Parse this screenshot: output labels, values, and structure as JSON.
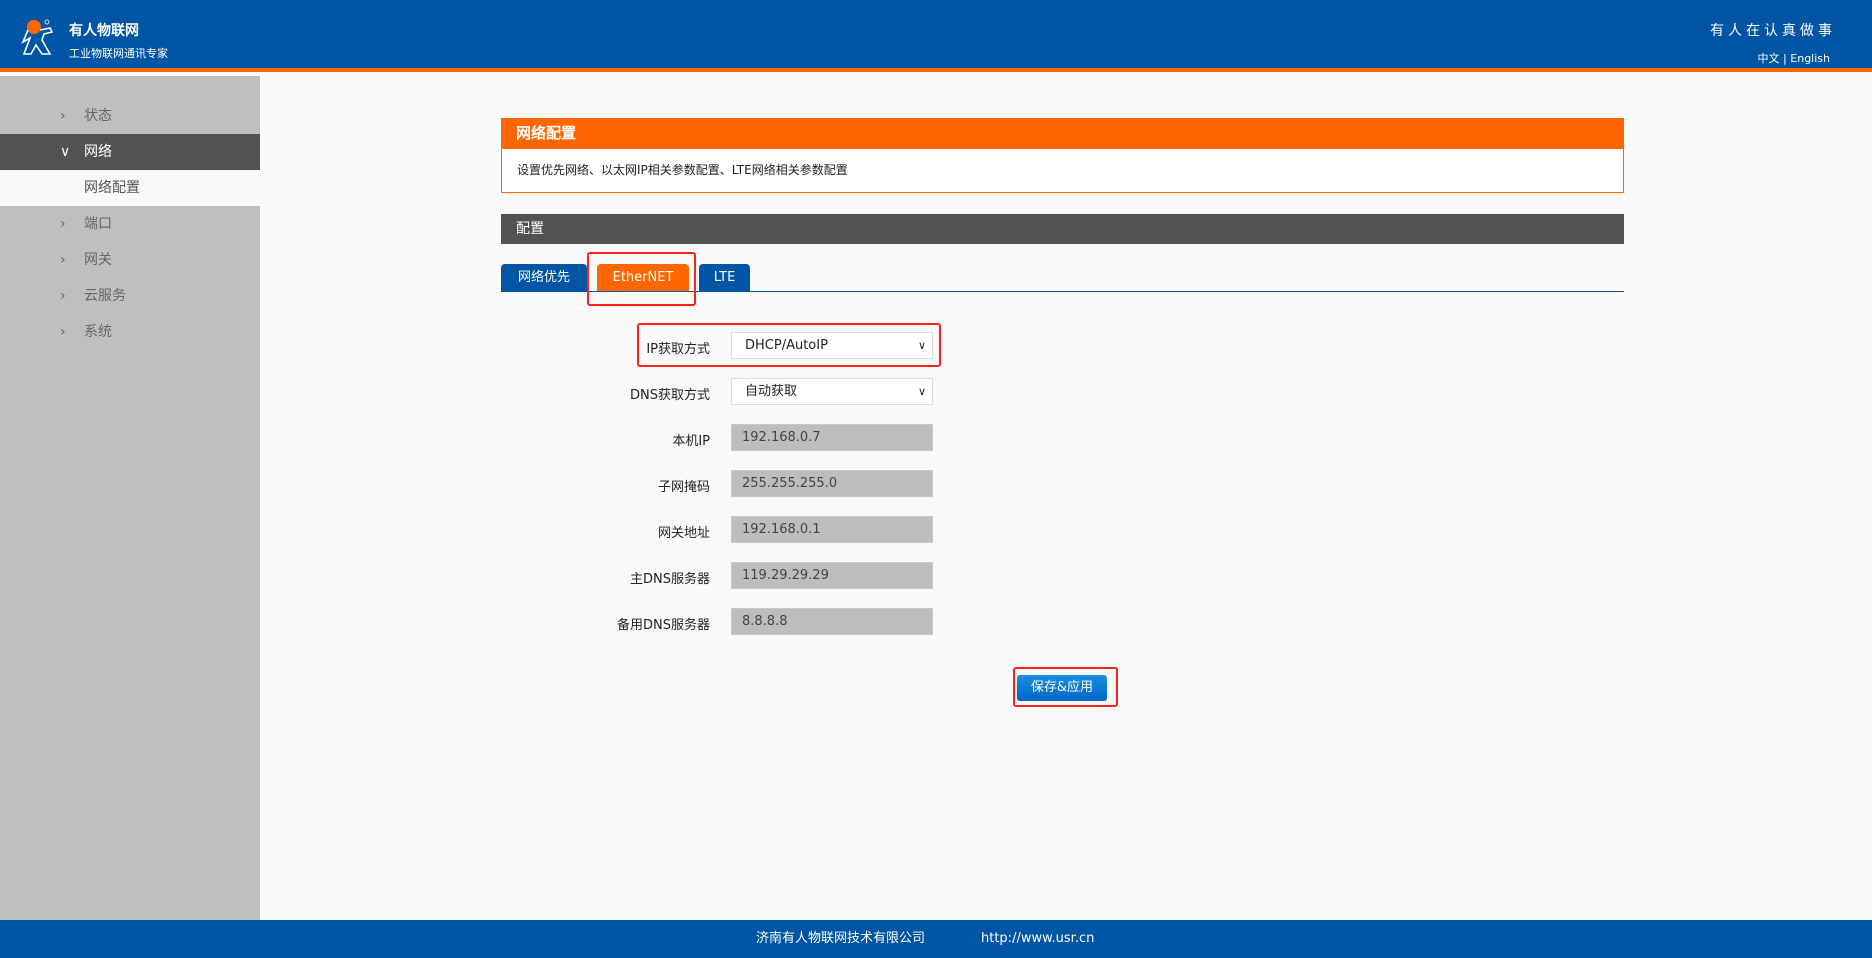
{
  "header": {
    "brand": "有人物联网",
    "slogan": "工业物联网通讯专家",
    "motto": "有人在认真做事",
    "lang_zh": "中文",
    "lang_sep": "|",
    "lang_en": "English",
    "accent": "#ff6600",
    "primary": "#0055a5"
  },
  "sidebar": {
    "items": [
      {
        "label": "状态"
      },
      {
        "label": "网络"
      },
      {
        "label": "网络配置"
      },
      {
        "label": "端口"
      },
      {
        "label": "网关"
      },
      {
        "label": "云服务"
      },
      {
        "label": "系统"
      }
    ]
  },
  "panel": {
    "title": "网络配置",
    "description": "设置优先网络、以太网IP相关参数配置、LTE网络相关参数配置",
    "config_title": "配置"
  },
  "tabs": [
    {
      "label": "网络优先"
    },
    {
      "label": "EtherNET"
    },
    {
      "label": "LTE"
    }
  ],
  "form": {
    "ip_mode": {
      "label": "IP获取方式",
      "value": "DHCP/AutoIP"
    },
    "dns_mode": {
      "label": "DNS获取方式",
      "value": "自动获取"
    },
    "local_ip": {
      "label": "本机IP",
      "value": "192.168.0.7"
    },
    "subnet": {
      "label": "子网掩码",
      "value": "255.255.255.0"
    },
    "gateway": {
      "label": "网关地址",
      "value": "192.168.0.1"
    },
    "dns1": {
      "label": "主DNS服务器",
      "value": "119.29.29.29"
    },
    "dns2": {
      "label": "备用DNS服务器",
      "value": "8.8.8.8"
    },
    "save_label": "保存&应用"
  },
  "footer": {
    "company": "济南有人物联网技术有限公司",
    "url": "http://www.usr.cn"
  }
}
